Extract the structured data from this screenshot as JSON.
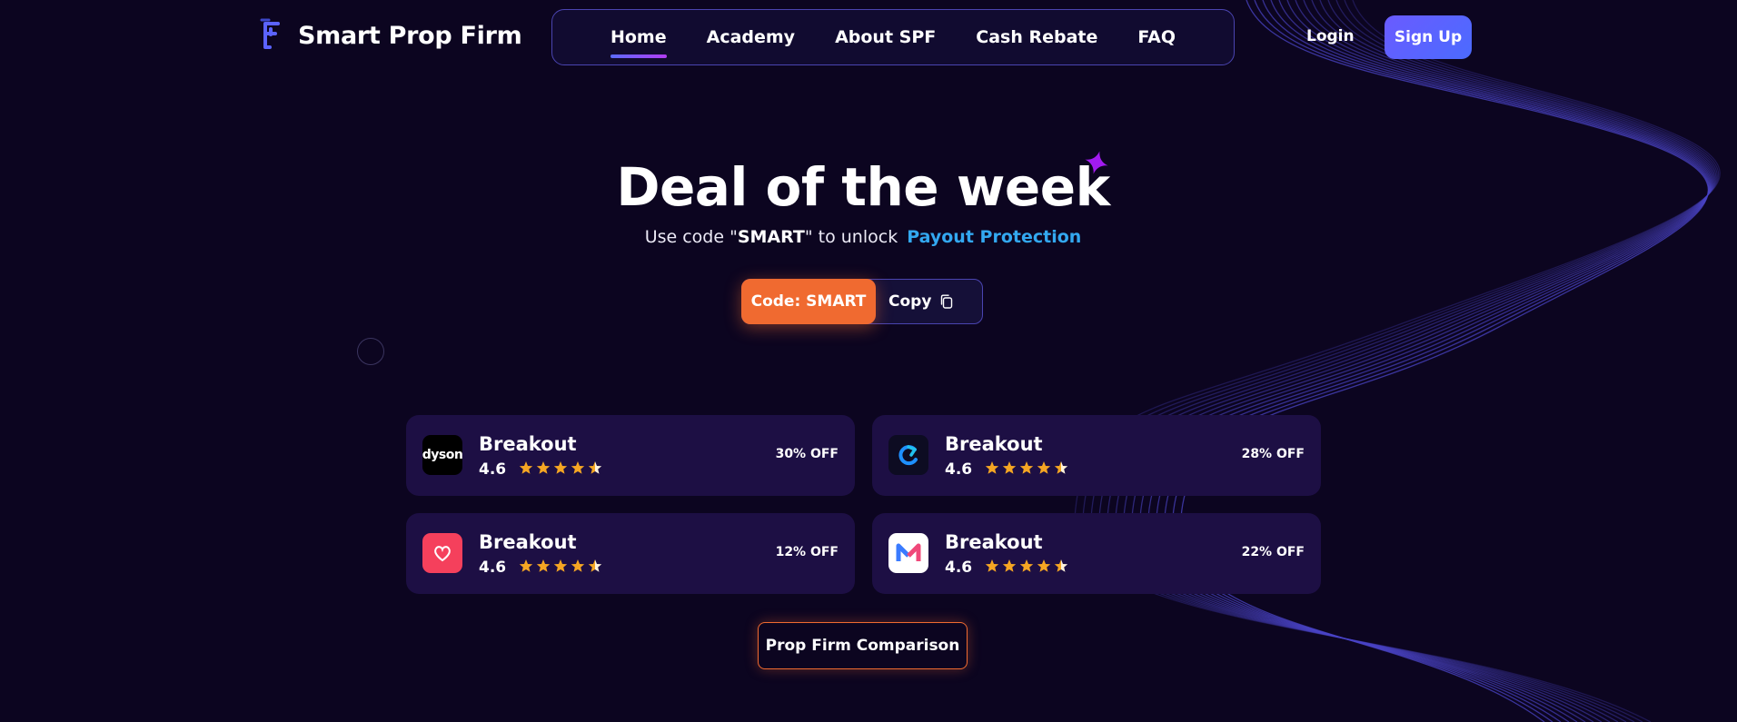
{
  "brand": {
    "name": "Smart Prop Firm"
  },
  "nav": {
    "items": [
      {
        "label": "Home",
        "active": true
      },
      {
        "label": "Academy",
        "active": false
      },
      {
        "label": "About SPF",
        "active": false
      },
      {
        "label": "Cash Rebate",
        "active": false
      },
      {
        "label": "FAQ",
        "active": false
      }
    ]
  },
  "auth": {
    "login_label": "Login",
    "signup_label": "Sign Up"
  },
  "hero": {
    "title": "Deal of the week",
    "sub_prefix": "Use code \"",
    "sub_code": "SMART",
    "sub_suffix": "\" to unlock",
    "sub_link": "Payout Protection",
    "code_label": "Code: SMART",
    "copy_label": "Copy"
  },
  "deals": [
    {
      "name": "Breakout",
      "rating": "4.6",
      "stars": 4.5,
      "discount": "30% OFF",
      "logo_icon": "dyson-logo",
      "logo_text": "dyson"
    },
    {
      "name": "Breakout",
      "rating": "4.6",
      "stars": 4.5,
      "discount": "28% OFF",
      "logo_icon": "circular-arrow-logo"
    },
    {
      "name": "Breakout",
      "rating": "4.6",
      "stars": 4.5,
      "discount": "12% OFF",
      "logo_icon": "heart-logo"
    },
    {
      "name": "Breakout",
      "rating": "4.6",
      "stars": 4.5,
      "discount": "22% OFF",
      "logo_icon": "m-letter-logo"
    }
  ],
  "cta": {
    "label": "Prop Firm Comparison"
  },
  "colors": {
    "background": "#0c0520",
    "accent_orange": "#f06a30",
    "accent_blue": "#33a8f0",
    "signup_purple": "#6a5bff",
    "card_bg": "#1d0f44",
    "star_gold": "#f5a623"
  }
}
